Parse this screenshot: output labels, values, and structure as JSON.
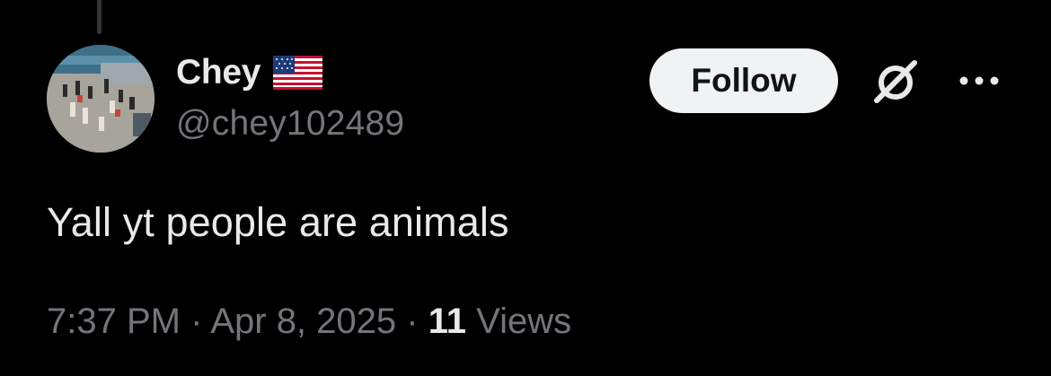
{
  "tweet": {
    "display_name": "Chey",
    "name_emoji": "us-flag",
    "handle": "@chey102489",
    "text": "Yall yt people are animals",
    "time": "7:37 PM",
    "separator": "·",
    "date": "Apr 8, 2025",
    "views_count": "11",
    "views_label": "Views"
  },
  "actions": {
    "follow_label": "Follow",
    "grok_icon": "grok-icon",
    "more_icon": "more-options-icon"
  },
  "colors": {
    "background": "#000000",
    "primary_text": "#e7e9ea",
    "secondary_text": "#71767b",
    "follow_bg": "#eff3f4",
    "follow_text": "#0f1419"
  }
}
